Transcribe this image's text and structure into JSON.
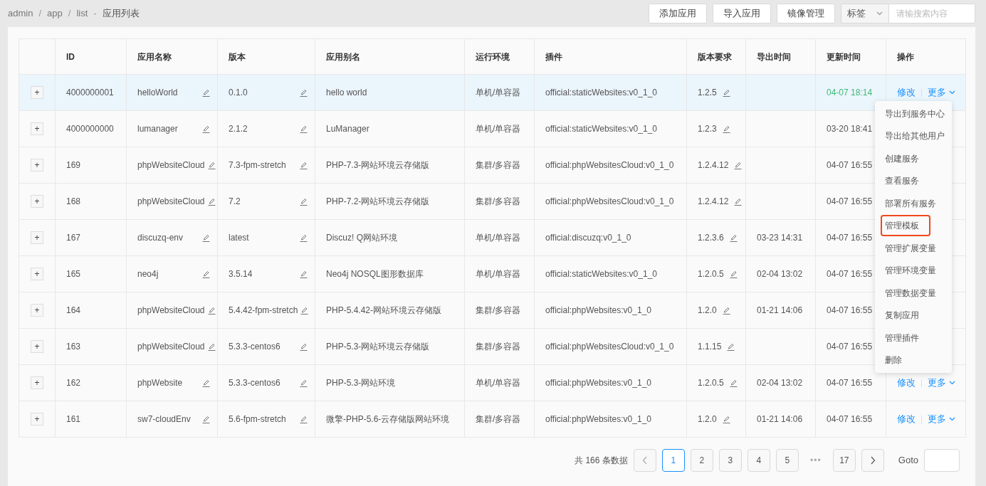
{
  "breadcrumb": [
    {
      "kind": "crumb",
      "text": "admin"
    },
    {
      "kind": "sep",
      "text": "/"
    },
    {
      "kind": "crumb",
      "text": "app"
    },
    {
      "kind": "sep",
      "text": "/"
    },
    {
      "kind": "crumb",
      "text": "list"
    },
    {
      "kind": "sep",
      "text": "-"
    },
    {
      "kind": "title",
      "text": "应用列表"
    }
  ],
  "toolbar": {
    "buttons": [
      "添加应用",
      "导入应用",
      "镜像管理"
    ],
    "tag_select": "标签",
    "search": {
      "placeholder": "请输搜索内容"
    }
  },
  "table": {
    "columns": [
      "ID",
      "应用名称",
      "版本",
      "应用别名",
      "运行环境",
      "插件",
      "版本要求",
      "导出时间",
      "更新时间",
      "操作"
    ],
    "rows": [
      {
        "expander": "+",
        "id": "4000000001",
        "name": "helloWorld",
        "version": "0.1.0",
        "alias": "hello world",
        "env": "单机/单容器",
        "plugin": "official:staticWebsites:v0_1_0",
        "requirement": "1.2.5",
        "updated": "04-07 18:14",
        "updated_new": true,
        "hovered": true,
        "edit": "修改",
        "more": "更多"
      },
      {
        "expander": "+",
        "id": "4000000000",
        "name": "lumanager",
        "version": "2.1.2",
        "alias": "LuManager",
        "env": "单机/单容器",
        "plugin": "official:staticWebsites:v0_1_0",
        "requirement": "1.2.3",
        "updated": "03-20 18:41",
        "updated_new": false,
        "hovered": false
      },
      {
        "expander": "+",
        "id": "169",
        "name": "phpWebsiteCloud",
        "version": "7.3-fpm-stretch",
        "alias": "PHP-7.3-网站环境云存储版",
        "env": "集群/多容器",
        "plugin": "official:phpWebsitesCloud:v0_1_0",
        "requirement": "1.2.4.12",
        "updated": "04-07 16:55",
        "updated_new": false,
        "hovered": false
      },
      {
        "expander": "+",
        "id": "168",
        "name": "phpWebsiteCloud",
        "version": "7.2",
        "alias": "PHP-7.2-网站环境云存储版",
        "env": "集群/多容器",
        "plugin": "official:phpWebsitesCloud:v0_1_0",
        "requirement": "1.2.4.12",
        "updated": "04-07 16:55",
        "updated_new": false,
        "hovered": false
      },
      {
        "expander": "+",
        "id": "167",
        "name": "discuzq-env",
        "version": "latest",
        "alias": "Discuz! Q网站环境",
        "env": "单机/单容器",
        "plugin": "official:discuzq:v0_1_0",
        "requirement": "1.2.3.6",
        "exported": "03-23 14:31",
        "updated": "04-07 16:55",
        "updated_new": false,
        "hovered": false
      },
      {
        "expander": "+",
        "id": "165",
        "name": "neo4j",
        "version": "3.5.14",
        "alias": "Neo4j NOSQL图形数据库",
        "env": "单机/单容器",
        "plugin": "official:staticWebsites:v0_1_0",
        "requirement": "1.2.0.5",
        "exported": "02-04 13:02",
        "updated": "04-07 16:55",
        "updated_new": false,
        "hovered": false
      },
      {
        "expander": "+",
        "id": "164",
        "name": "phpWebsiteCloud",
        "version": "5.4.42-fpm-stretch",
        "alias": "PHP-5.4.42-网站环境云存储版",
        "env": "集群/多容器",
        "plugin": "official:phpWebsites:v0_1_0",
        "requirement": "1.2.0",
        "exported": "01-21 14:06",
        "updated": "04-07 16:55",
        "updated_new": false,
        "hovered": false
      },
      {
        "expander": "+",
        "id": "163",
        "name": "phpWebsiteCloud",
        "version": "5.3.3-centos6",
        "alias": "PHP-5.3-网站环境云存储版",
        "env": "集群/多容器",
        "plugin": "official:phpWebsitesCloud:v0_1_0",
        "requirement": "1.1.15",
        "updated": "04-07 16:55",
        "updated_new": false,
        "hovered": false
      },
      {
        "expander": "+",
        "id": "162",
        "name": "phpWebsite",
        "version": "5.3.3-centos6",
        "alias": "PHP-5.3-网站环境",
        "env": "单机/单容器",
        "plugin": "official:phpWebsites:v0_1_0",
        "requirement": "1.2.0.5",
        "exported": "02-04 13:02",
        "updated": "04-07 16:55",
        "updated_new": false,
        "hovered": false,
        "edit": "修改",
        "more": "更多"
      },
      {
        "expander": "+",
        "id": "161",
        "name": "sw7-cloudEnv",
        "version": "5.6-fpm-stretch",
        "alias": "微擎-PHP-5.6-云存储版网站环境",
        "env": "集群/多容器",
        "plugin": "official:phpWebsites:v0_1_0",
        "requirement": "1.2.0",
        "exported": "01-21 14:06",
        "updated": "04-07 16:55",
        "updated_new": false,
        "hovered": false,
        "edit": "修改",
        "more": "更多"
      }
    ]
  },
  "more_menu": {
    "items": [
      {
        "label": "导出到服务中心",
        "focused": false
      },
      {
        "label": "导出给其他用户",
        "focused": false
      },
      {
        "label": "创建服务",
        "focused": false
      },
      {
        "label": "查看服务",
        "focused": false
      },
      {
        "label": "部署所有服务",
        "focused": false
      },
      {
        "label": "管理模板",
        "focused": true
      },
      {
        "label": "管理扩展变量",
        "focused": false
      },
      {
        "label": "管理环境变量",
        "focused": false
      },
      {
        "label": "管理数据变量",
        "focused": false
      },
      {
        "label": "复制应用",
        "focused": false
      },
      {
        "label": "管理插件",
        "focused": false
      },
      {
        "label": "删除",
        "focused": false
      }
    ]
  },
  "pagination": {
    "total": "共 166 条数据",
    "pages": [
      {
        "label": "1",
        "selected": true
      },
      {
        "label": "2",
        "selected": false
      },
      {
        "label": "3",
        "selected": false
      },
      {
        "label": "4",
        "selected": false
      },
      {
        "label": "5",
        "selected": false
      },
      {
        "label": "•••",
        "kind": "ellipsis"
      },
      {
        "label": "17",
        "selected": false
      }
    ],
    "goto_label": "Goto"
  }
}
